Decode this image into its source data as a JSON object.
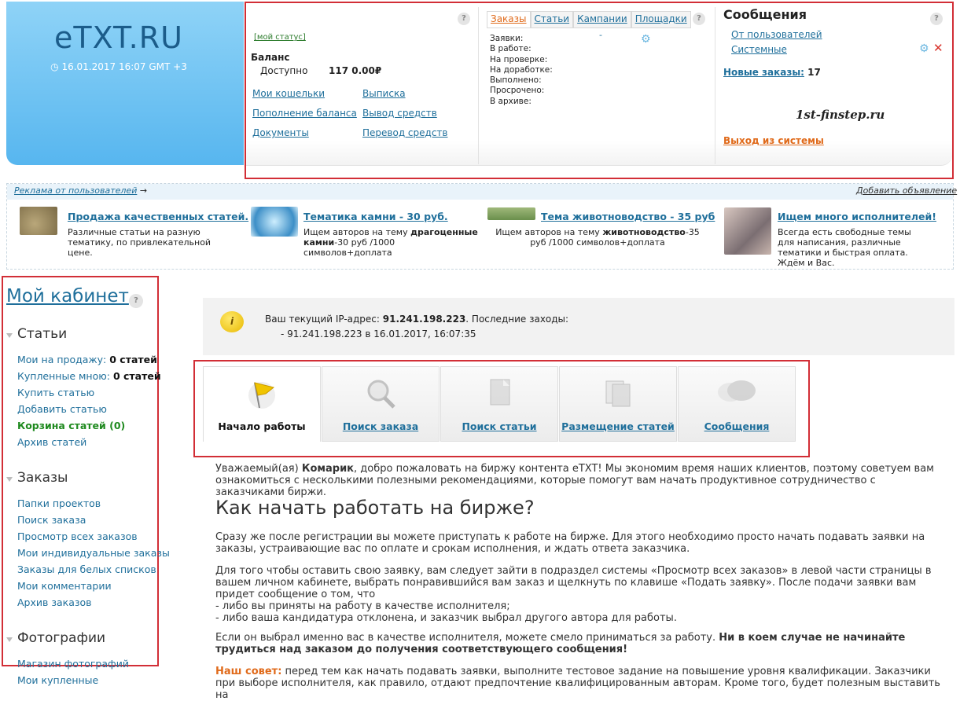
{
  "logo": {
    "text": "eTXT.RU",
    "datetime": "16.01.2017 16:07 GMT +3"
  },
  "account": {
    "my_status": "[мой статус]",
    "balance_label": "Баланс",
    "available_label": "Доступно",
    "available_value": "117 0.00₽",
    "links_left": [
      "Мои кошельки",
      "Пополнение баланса",
      "Документы"
    ],
    "links_right": [
      "Выписка",
      "Вывод средств",
      "Перевод средств"
    ]
  },
  "orders": {
    "tabs": [
      "Заказы",
      "Статьи",
      "Кампании",
      "Площадки"
    ],
    "active_tab": "Заказы",
    "dash": "-",
    "rows": [
      "Заявки:",
      "В работе:",
      "На проверке:",
      "На доработке:",
      "Выполнено:",
      "Просрочено:",
      "В архиве:"
    ]
  },
  "messages": {
    "title": "Сообщения",
    "from_users": "От пользователей",
    "system": "Системные",
    "new_orders_label": "Новые заказы:",
    "new_orders_count": "17",
    "watermark": "1st-finstep.ru",
    "logout": "Выход из системы"
  },
  "ads": {
    "header": "Реклама от пользователей",
    "arrow": "→",
    "add_link": "Добавить объявление",
    "items": [
      {
        "title": "Продажа качественных статей.",
        "text": "Различные статьи на разную тематику, по привлекательной цене."
      },
      {
        "title": "Тематика камни - 30 руб.",
        "text_pre": "Ищем авторов на тему ",
        "text_bold": "драгоценные камни",
        "text_post": "-30 руб /1000 символов+доплата"
      },
      {
        "title": "Тема животноводство - 35 руб",
        "text_pre": "Ищем авторов на тему ",
        "text_bold": "животноводство",
        "text_post": "-35 руб /1000 символов+доплата"
      },
      {
        "title": "Ищем много исполнителей!",
        "text": "Всегда есть свободные темы для написания, различные тематики и быстрая оплата. Ждём и Вас."
      }
    ]
  },
  "sidebar": {
    "title": "Мой кабинет",
    "sections": [
      {
        "title": "Статьи",
        "items": [
          [
            "Мои на продажу: ",
            "0 статей"
          ],
          [
            "Купленные мною: ",
            "0 статей"
          ],
          [
            "Купить статью",
            ""
          ],
          [
            "Добавить статью",
            ""
          ],
          [
            "Корзина статей (0)",
            ""
          ],
          [
            "Архив статей",
            ""
          ]
        ]
      },
      {
        "title": "Заказы",
        "items": [
          [
            "Папки проектов",
            ""
          ],
          [
            "Поиск заказа",
            ""
          ],
          [
            "Просмотр всех заказов",
            ""
          ],
          [
            "Мои индивидуальные заказы",
            ""
          ],
          [
            "Заказы для белых списков",
            ""
          ],
          [
            "Мои комментарии",
            ""
          ],
          [
            "Архив заказов",
            ""
          ]
        ]
      },
      {
        "title": "Фотографии",
        "items": [
          [
            "Магазин фотографий",
            ""
          ],
          [
            "Мои купленные",
            ""
          ]
        ]
      }
    ]
  },
  "ip": {
    "label": "Ваш текущий IP-адрес: ",
    "ip": "91.241.198.223",
    "last_label": ". Последние заходы:",
    "last_entry": "- 91.241.198.223 в 16.01.2017, 16:07:35"
  },
  "nav": [
    "Начало работы",
    "Поиск заказа",
    "Поиск статьи",
    "Размещение статей",
    "Сообщения"
  ],
  "content": {
    "greet_pre": "Уважаемый(ая) ",
    "greet_name": "Комарик",
    "greet_post": ", добро пожаловать на биржу контента eTXT! Мы экономим время наших клиентов, поэтому советуем вам ознакомиться с несколькими полезными рекомендациями, которые помогут вам начать продуктивное сотрудничество с заказчиками биржи.",
    "heading": "Как начать работать на бирже?",
    "p1": "Сразу же после регистрации вы можете приступать к работе на бирже. Для этого необходимо просто начать подавать заявки на заказы, устраивающие вас по оплате и срокам исполнения, и ждать ответа заказчика.",
    "p2a": "Для того чтобы оставить свою заявку, вам следует зайти в подраздел системы «Просмотр всех заказов» в левой части страницы в вашем личном кабинете, выбрать понравившийся вам заказ и щелкнуть по клавише «Подать заявку». После подачи заявки вам придет сообщение о том, что",
    "p2b": "- либо вы приняты на работу в качестве исполнителя;",
    "p2c": "- либо ваша кандидатура отклонена, и заказчик выбрал другого автора для работы.",
    "p3a": "Если он выбрал именно вас в качестве исполнителя, можете смело приниматься за работу. ",
    "p3b": "Ни в коем случае не начинайте трудиться над заказом до получения соответствующего сообщения!",
    "tip_label": "Наш совет:",
    "tip": " перед тем как начать подавать заявки, выполните тестовое задание на повышение уровня квалификации. Заказчики при выборе исполнителя, как правило, отдают предпочтение квалифицированным авторам. Кроме того, будет полезным выставить на"
  },
  "qmark": "?"
}
